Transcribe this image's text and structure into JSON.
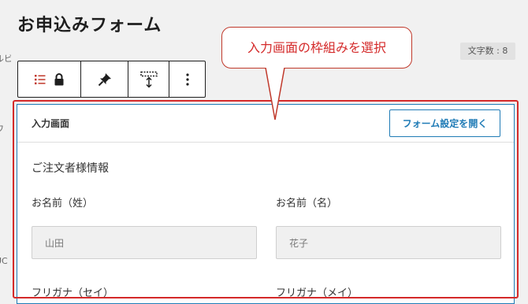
{
  "left_edge": [
    "ルビ",
    "ワ",
    "UC"
  ],
  "page_title": "お申込みフォーム",
  "char_count": "文字数 : 8",
  "toolbar": {
    "icons": [
      "list-icon",
      "lock-icon",
      "pin-icon",
      "resize-height-icon",
      "more-vertical-icon"
    ],
    "accent_color": "#c0392b"
  },
  "callout": {
    "text": "入力画面の枠組みを選択",
    "color": "#d42a2a"
  },
  "form": {
    "panel_title": "入力画面",
    "open_settings_button": "フォーム設定を開く",
    "section_heading": "ご注文者様情報",
    "fields": [
      {
        "label": "お名前（姓）",
        "value": "山田"
      },
      {
        "label": "お名前（名）",
        "value": "花子"
      },
      {
        "label": "フリガナ（セイ）"
      },
      {
        "label": "フリガナ（メイ）"
      }
    ],
    "accent_color": "#1f7bb6"
  }
}
